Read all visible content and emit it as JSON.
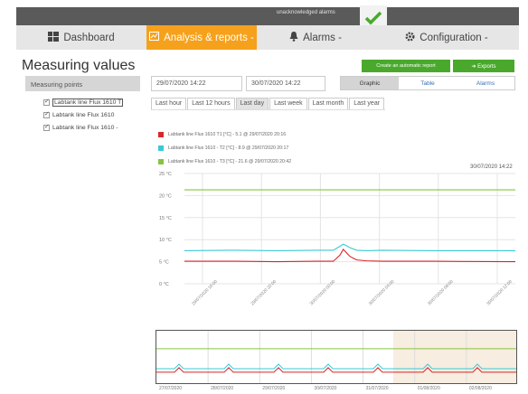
{
  "header": {
    "ack_text": "unacknowledged alarms",
    "check_icon": "check-icon",
    "accent": "#f6a11b",
    "green": "#4aa92c"
  },
  "nav": [
    {
      "label": "Dashboard",
      "icon": "dashboard-icon",
      "active": false
    },
    {
      "label": "Analysis & reports -",
      "icon": "chart-icon",
      "active": true
    },
    {
      "label": "Alarms -",
      "icon": "bell-icon",
      "active": false
    },
    {
      "label": "Configuration -",
      "icon": "gear-icon",
      "active": false
    }
  ],
  "page": {
    "title": "Measuring values",
    "points_header": "Measuring points",
    "points": [
      {
        "label": "Labtank line Flux 1610 T",
        "selected": true
      },
      {
        "label": "Labtank line Flux 1610",
        "selected": false
      },
      {
        "label": "Labtank line Flux 1610 -",
        "selected": false
      }
    ]
  },
  "toolbar": {
    "auto_report": "Create an automatic report",
    "exports": "➜ Exports",
    "date_from": "29/07/2020 14:22",
    "date_to": "30/07/2020 14:22",
    "views": [
      {
        "label": "Graphic",
        "on": true
      },
      {
        "label": "Table",
        "on": false
      },
      {
        "label": "Alarms",
        "on": false
      }
    ],
    "ranges": [
      {
        "label": "Last hour",
        "on": false
      },
      {
        "label": "Last 12 hours",
        "on": false
      },
      {
        "label": "Last day",
        "on": true
      },
      {
        "label": "Last week",
        "on": false
      },
      {
        "label": "Last month",
        "on": false
      },
      {
        "label": "Last year",
        "on": false
      }
    ]
  },
  "legend": [
    {
      "color": "#d8272a",
      "text": "Labtank line Flux 1610 T1 [°C] - 5.1 @ 29/07/2020 20:16"
    },
    {
      "color": "#3cc8d6",
      "text": "Labtank line Flux 1610 - T2 [°C] - 8.9 @ 29/07/2020 20:17"
    },
    {
      "color": "#86c440",
      "text": "Labtank line Flux 1610 - T3 [°C] - 21.6 @ 29/07/2020 20:42"
    }
  ],
  "timestamp": "30/07/2020 14:22",
  "chart_data": {
    "type": "line",
    "ylabel": "",
    "ylim": [
      0,
      25
    ],
    "yticks": [
      "25 °C",
      "20 °C",
      "15 °C",
      "10 °C",
      "5 °C",
      "0 °C"
    ],
    "xticks": [
      "29/07/2020 16:00",
      "29/07/2020 20:00",
      "30/07/2020 00:00",
      "30/07/2020 04:00",
      "30/07/2020 08:00",
      "30/07/2020 12:00"
    ],
    "series": [
      {
        "color": "#86c440",
        "x": [
          0,
          100
        ],
        "y": [
          21.3,
          21.3
        ]
      },
      {
        "color": "#3cc8d6",
        "x": [
          0,
          15,
          28,
          40,
          45,
          47,
          48,
          50,
          52,
          55,
          60,
          75,
          100
        ],
        "y": [
          7.5,
          7.6,
          7.5,
          7.6,
          7.6,
          8.5,
          9.0,
          8.2,
          7.6,
          7.5,
          7.6,
          7.5,
          7.5
        ]
      },
      {
        "color": "#d8272a",
        "x": [
          0,
          15,
          28,
          40,
          45,
          47,
          48,
          50,
          52,
          55,
          60,
          75,
          100
        ],
        "y": [
          5.1,
          5.1,
          5.0,
          5.1,
          5.1,
          6.5,
          7.8,
          6.2,
          5.4,
          5.2,
          5.1,
          5.1,
          5.0
        ]
      }
    ]
  },
  "navigator": {
    "labels": [
      "27/07/2020",
      "28/07/2020",
      "29/07/2020",
      "30/07/2020",
      "31/07/2020",
      "01/08/2020",
      "02/08/2020"
    ],
    "shade": "#f7ede0"
  }
}
